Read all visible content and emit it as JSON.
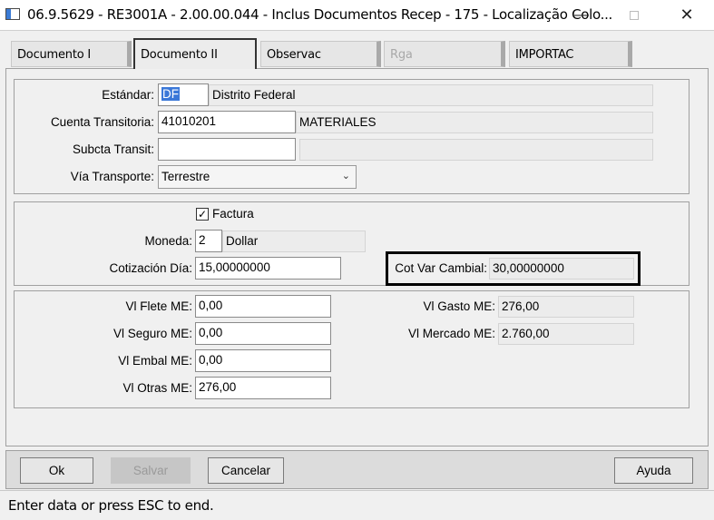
{
  "window": {
    "title": "06.9.5629 - RE3001A - 2.00.00.044 - Inclus Documentos Recep - 175 - Localização Colo..."
  },
  "tabs": [
    {
      "label": "Documento  I"
    },
    {
      "label": "Documento II"
    },
    {
      "label": "Observac"
    },
    {
      "label": "Rga"
    },
    {
      "label": "IMPORTAC"
    }
  ],
  "form": {
    "estandar": {
      "label": "Estándar:",
      "code": "DF",
      "desc": "Distrito Federal"
    },
    "cuenta": {
      "label": "Cuenta Transitoria:",
      "value": "41010201",
      "desc": "MATERIALES"
    },
    "subcta": {
      "label": "Subcta Transit:",
      "value": "",
      "desc": ""
    },
    "via": {
      "label": "Vía Transporte:",
      "value": "Terrestre"
    },
    "factura": {
      "label": "Factura",
      "checked": true
    },
    "moneda": {
      "label": "Moneda:",
      "value": "2",
      "desc": "Dollar"
    },
    "cotizacion": {
      "label": "Cotización Día:",
      "value": "15,00000000"
    },
    "cot_var": {
      "label": "Cot Var Cambial:",
      "value": "30,00000000"
    },
    "flete": {
      "label": "Vl Flete ME:",
      "value": "0,00"
    },
    "seguro": {
      "label": "Vl Seguro ME:",
      "value": "0,00"
    },
    "embal": {
      "label": "Vl Embal ME:",
      "value": "0,00"
    },
    "otras": {
      "label": "Vl Otras ME:",
      "value": "276,00"
    },
    "gasto": {
      "label": "Vl Gasto ME:",
      "value": "276,00"
    },
    "mercado": {
      "label": "Vl Mercado ME:",
      "value": "2.760,00"
    }
  },
  "buttons": {
    "ok": "Ok",
    "salvar": "Salvar",
    "cancelar": "Cancelar",
    "ayuda": "Ayuda"
  },
  "status": "Enter data or press ESC to end."
}
